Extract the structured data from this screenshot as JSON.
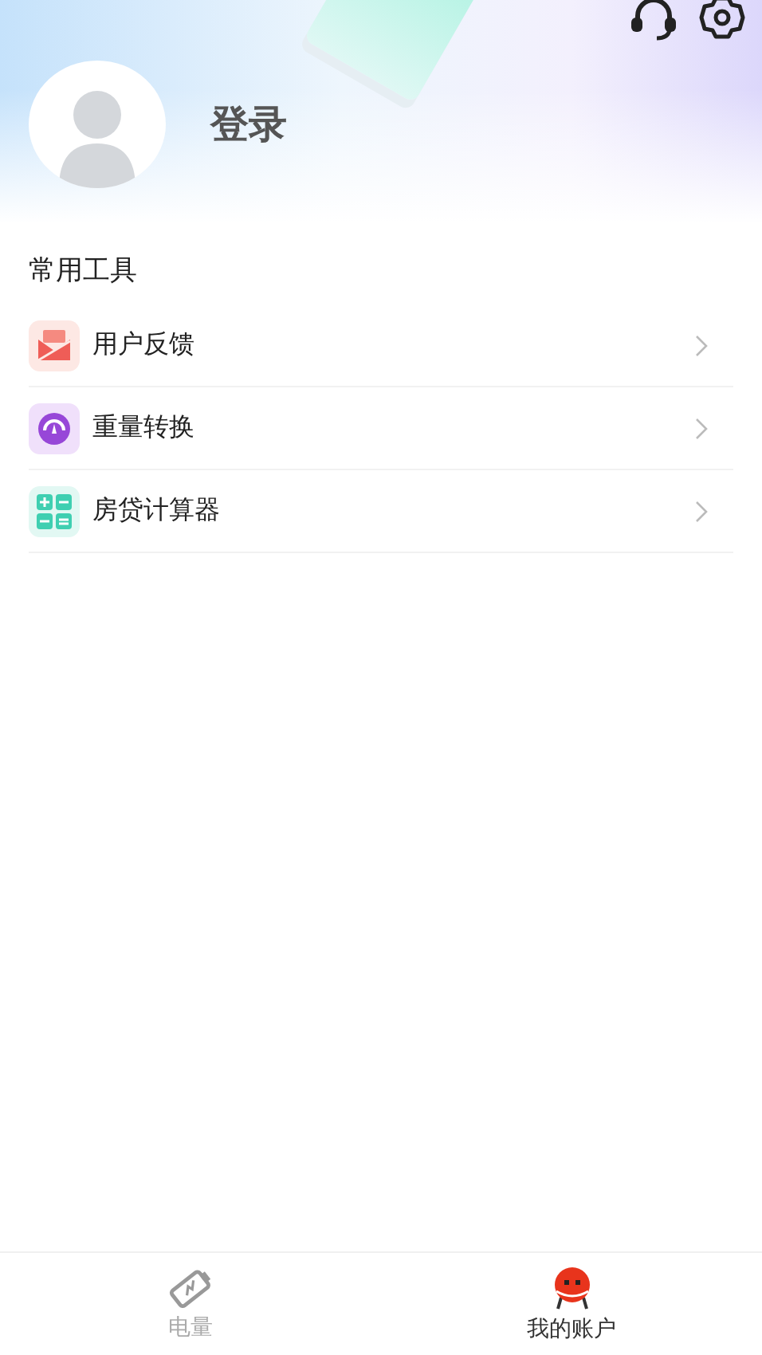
{
  "profile": {
    "login_label": "登录"
  },
  "section": {
    "title": "常用工具",
    "tools": [
      {
        "kind": "mail",
        "label": "用户反馈"
      },
      {
        "kind": "gauge",
        "label": "重量转换"
      },
      {
        "kind": "grid",
        "label": "房贷计算器"
      }
    ]
  },
  "tab_bar": [
    {
      "kind": "battery",
      "label": "电量",
      "selected": false
    },
    {
      "kind": "mascot",
      "label": "我的账户",
      "selected": true
    }
  ]
}
